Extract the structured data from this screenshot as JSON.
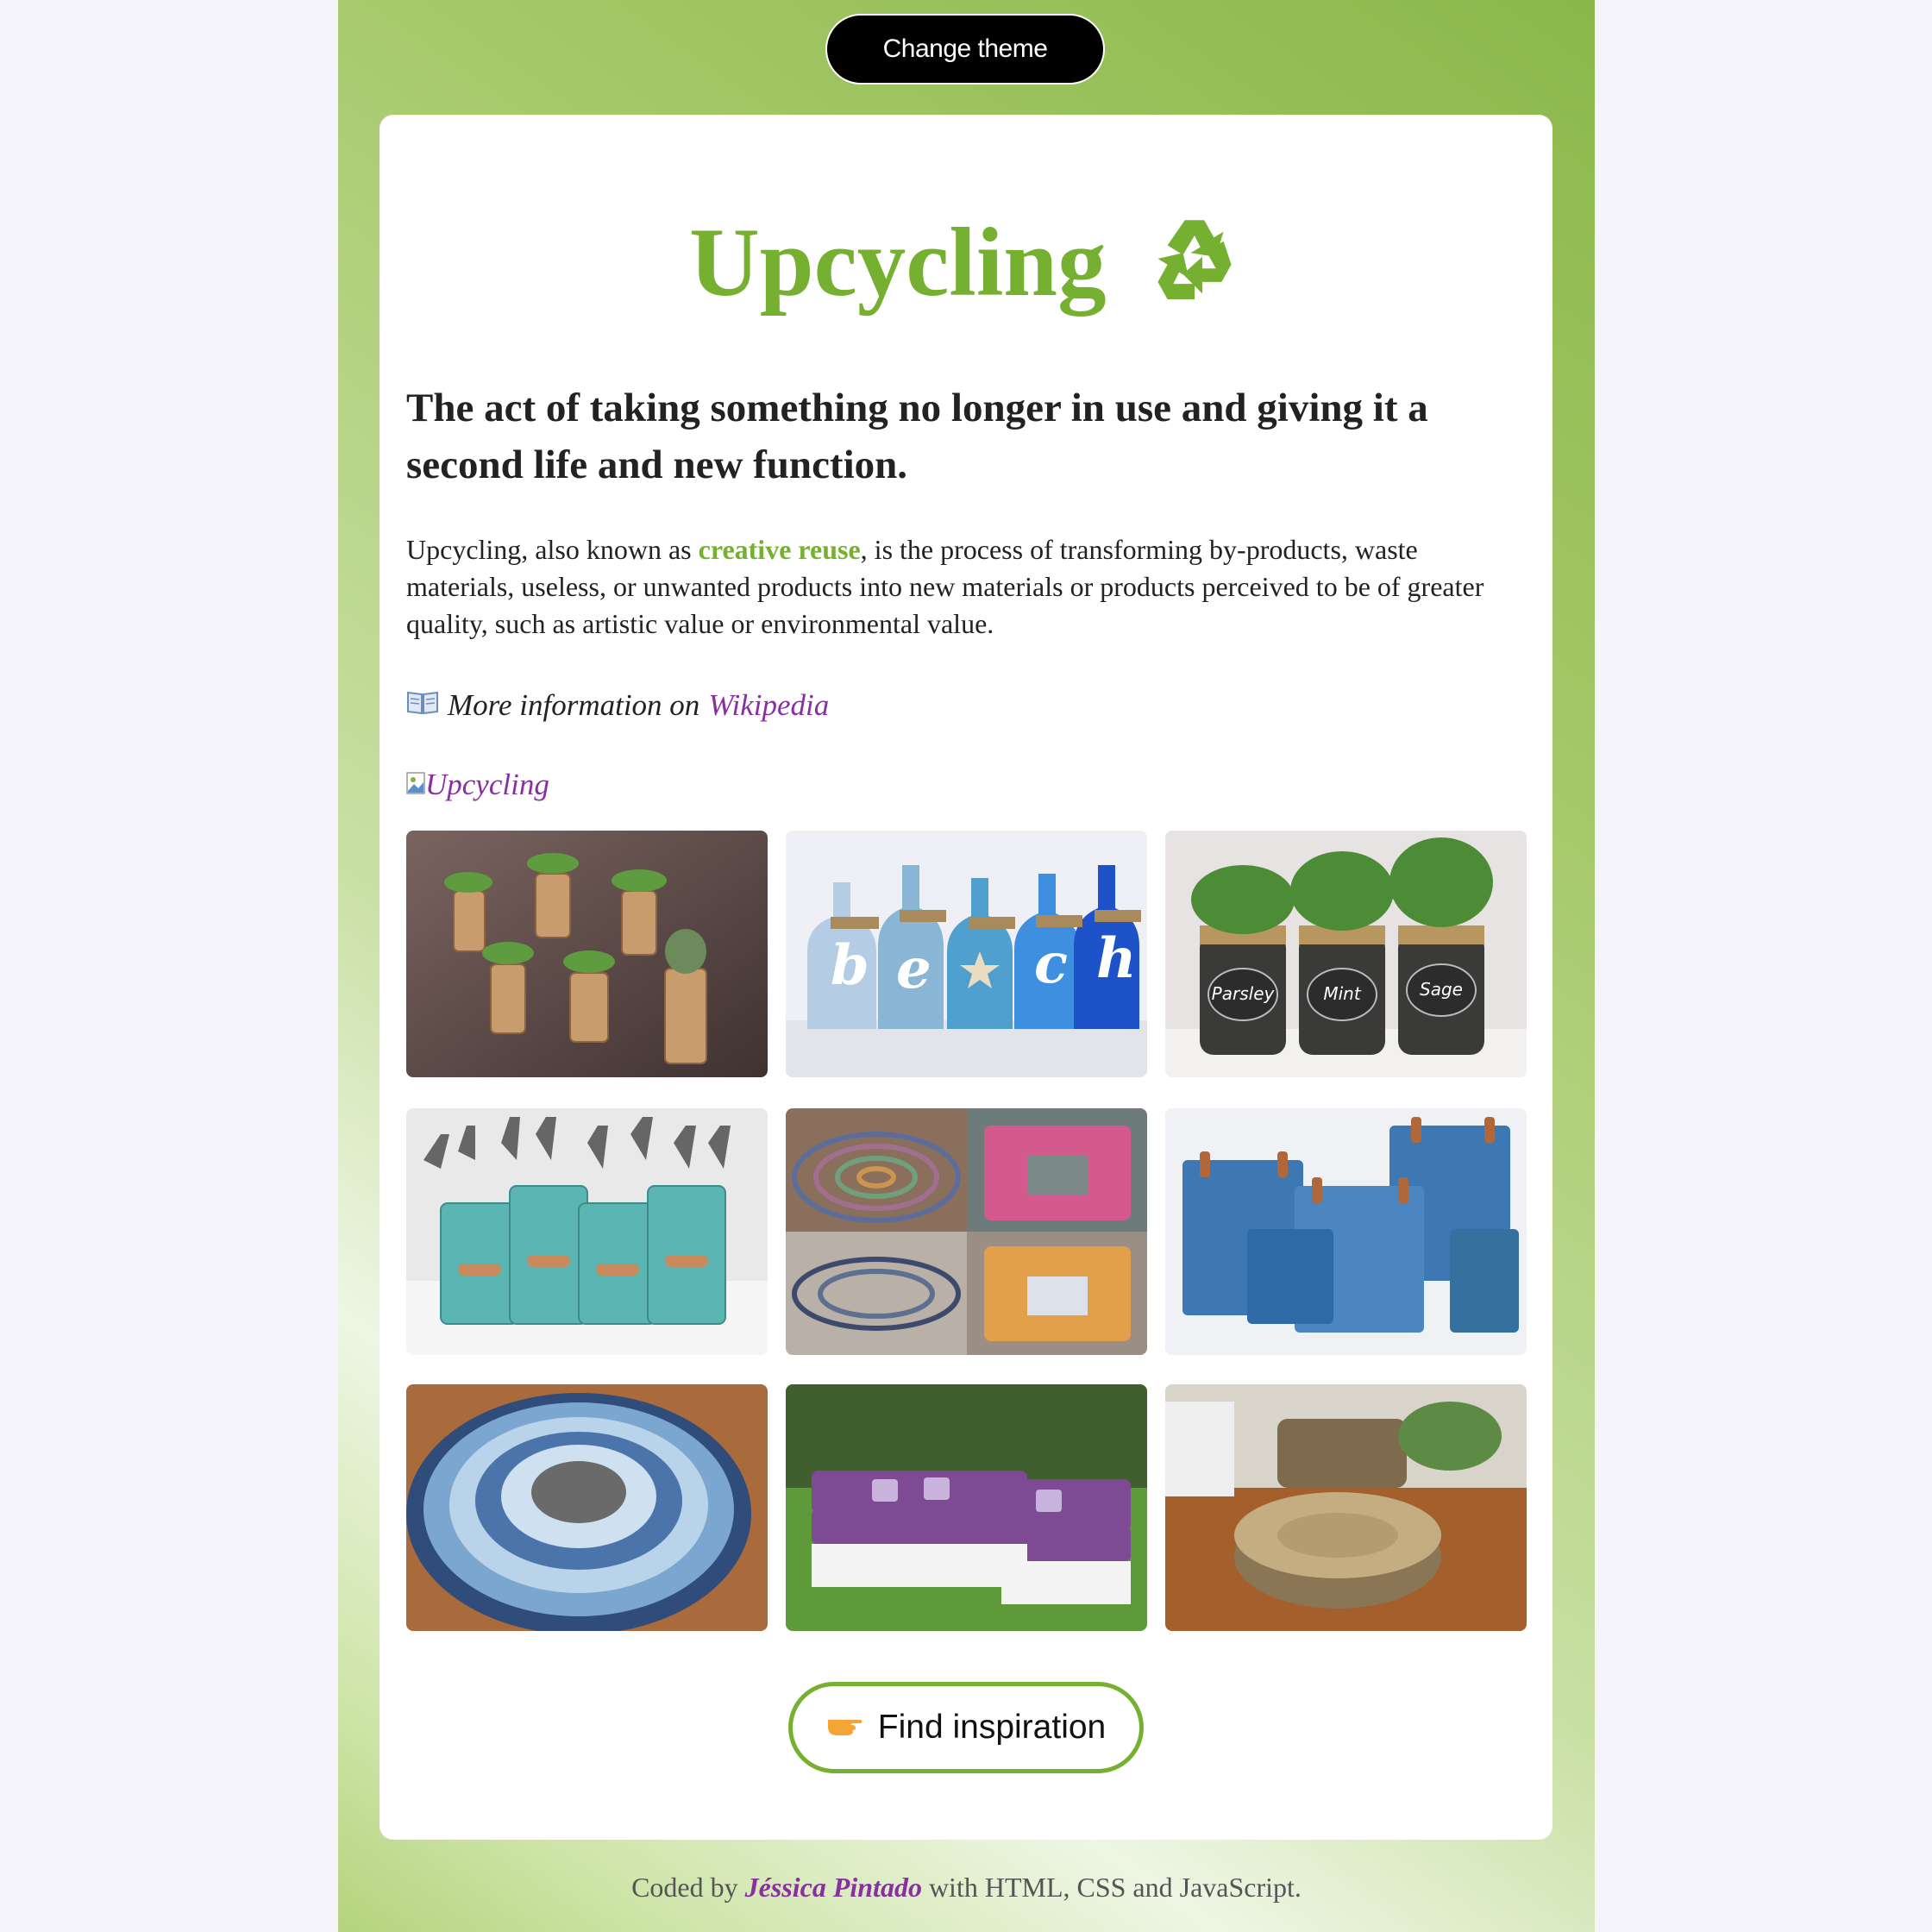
{
  "theme_button": {
    "label": "Change theme"
  },
  "header": {
    "title": "Upcycling",
    "title_icon": "recycle-icon"
  },
  "subtitle": "The act of taking something no longer in use and giving it a second life and new function.",
  "description": {
    "before": "Upcycling, also known as ",
    "highlight": "creative reuse",
    "after": ", is the process of transforming by-products, waste materials, useless, or unwanted products into new materials or products perceived to be of greater quality, such as artistic value or environmental value."
  },
  "more_info": {
    "icon": "book-icon",
    "prefix": "More information on",
    "link_label": "Wikipedia"
  },
  "broken_image_alt": "Upcycling",
  "gallery_items": [
    "cork-planters-photo",
    "painted-bottles-photo",
    "herb-jars-photo",
    "tin-can-organizer-photo",
    "paper-bowl-frame-photo",
    "denim-baskets-photo",
    "rag-rug-photo",
    "pallet-sofa-photo",
    "tire-ottoman-photo"
  ],
  "gallery_text": {
    "bottle_letters": [
      "b",
      "e",
      "c",
      "h"
    ],
    "jar_labels": [
      "Parsley",
      "Mint",
      "Sage"
    ]
  },
  "inspire_button": {
    "icon": "pointing-hand-icon",
    "label": "Find inspiration"
  },
  "footer": {
    "prefix": "Coded by",
    "author": "Jéssica Pintado",
    "suffix": "with HTML, CSS and JavaScript."
  },
  "colors": {
    "accent": "#76b030",
    "link": "#8a2ea3",
    "button_dark": "#000000"
  }
}
